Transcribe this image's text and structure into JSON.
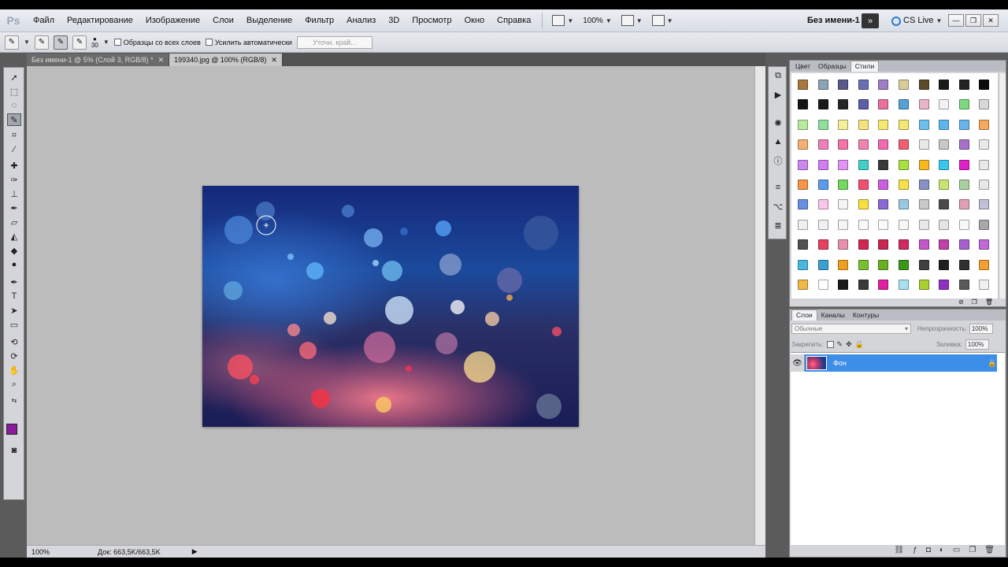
{
  "app": {
    "logo": "Ps"
  },
  "menu": {
    "items": [
      "Файл",
      "Редактирование",
      "Изображение",
      "Слои",
      "Выделение",
      "Фильтр",
      "Анализ",
      "3D",
      "Просмотр",
      "Окно",
      "Справка"
    ],
    "zoom": "100%",
    "doc_title": "Без имени-1",
    "cs_live": "CS Live"
  },
  "options": {
    "brush_size": "30",
    "sample_all_layers": "Образцы со всех слоев",
    "auto_enhance": "Усилить автоматически",
    "refine_edge": "Уточн. край..."
  },
  "tabs": [
    {
      "label": "Без имени-1 @ 5% (Слой 3, RGB/8) *",
      "active": false
    },
    {
      "label": "199340.jpg @ 100% (RGB/8)",
      "active": true
    }
  ],
  "status": {
    "zoom": "100%",
    "doc_size": "Док: 663,5K/663,5K"
  },
  "colors": {
    "foreground": "#8b1a9c",
    "background": "#ffffff",
    "layer_selected": "#3d8ee8"
  },
  "styles_panel": {
    "tabs": [
      {
        "label": "Цвет",
        "active": false
      },
      {
        "label": "Образцы",
        "active": false
      },
      {
        "label": "Стили",
        "active": true
      }
    ],
    "swatches": [
      [
        "#a8783e",
        "#8aa3b5",
        "#585a8a",
        "#6a6fb5",
        "#9e7ec4",
        "#d8cc9a",
        "#5a4a2a",
        "#1b1b1b",
        "#232323",
        "#0d0d0d"
      ],
      [
        "#141414",
        "#1a1a1a",
        "#262626",
        "#5a5fa8",
        "#e8709a",
        "#57a0d8",
        "#e8b4c8",
        "#f2f2f2",
        "#7ed87e",
        "#d8d8d8"
      ],
      [
        "#b8ec9c",
        "#8ee09a",
        "#f4f09a",
        "#f6e27a",
        "#f4ea72",
        "#f4e872",
        "#6cc0ee",
        "#5cb6ee",
        "#6ab4ee",
        "#f4a860"
      ],
      [
        "#f4b070",
        "#f07eb8",
        "#f274a8",
        "#f084b0",
        "#f06ab0",
        "#f06070",
        "#e8e8e8",
        "#c8c8c8",
        "#a870c8",
        "#e8e8e8"
      ],
      [
        "#cc88ee",
        "#d27ef0",
        "#e494f6",
        "#40d0c8",
        "#3a3a3a",
        "#a8e040",
        "#f8b820",
        "#38c8ee",
        "#e020c8",
        "#e8e8e8"
      ],
      [
        "#f89448",
        "#5c9af0",
        "#74d860",
        "#f05070",
        "#c860e0",
        "#f8e048",
        "#8890c8",
        "#c8e470",
        "#a8d0a0",
        "#e8e8e8"
      ],
      [
        "#6890e0",
        "#f8c8ec",
        "#f4f4f4",
        "#f8e040",
        "#8a6ad0",
        "#9ac8e0",
        "#c8c8c8",
        "#4a4a4a",
        "#e0a0b8",
        "#c0c0d8"
      ],
      [
        "#eeeeee",
        "#f0f0f0",
        "#f4f4f4",
        "#f8f8f8",
        "#fafafa",
        "#f6f6f6",
        "#e8e8e8",
        "#e4e4e4",
        "#f8f8f8",
        "#a8a8a8"
      ],
      [
        "#505050",
        "#e84060",
        "#e890b0",
        "#d0284c",
        "#c82850",
        "#d02860",
        "#c058c8",
        "#c040a8",
        "#a860d0",
        "#c06ad8"
      ],
      [
        "#48b8e0",
        "#3aa0d0",
        "#f0a020",
        "#78c030",
        "#68b020",
        "#389818",
        "#404040",
        "#202020",
        "#303030",
        "#f0a030"
      ],
      [
        "#f0b848",
        "#ffffff",
        "#1a1a1a",
        "#3a3a3a",
        "#e020a0",
        "#a8e0f0",
        "#a8d030",
        "#9030c0",
        "#5a5a5a",
        "#f0f0f0"
      ]
    ]
  },
  "layers_panel": {
    "tabs": [
      {
        "label": "Слои",
        "active": true
      },
      {
        "label": "Каналы",
        "active": false
      },
      {
        "label": "Контуры",
        "active": false
      }
    ],
    "blend_mode": "Обычные",
    "opacity_label": "Непрозрачность:",
    "opacity": "100%",
    "lock_label": "Закрепить:",
    "fill_label": "Заливка:",
    "fill": "100%",
    "layer_name": "Фон"
  }
}
